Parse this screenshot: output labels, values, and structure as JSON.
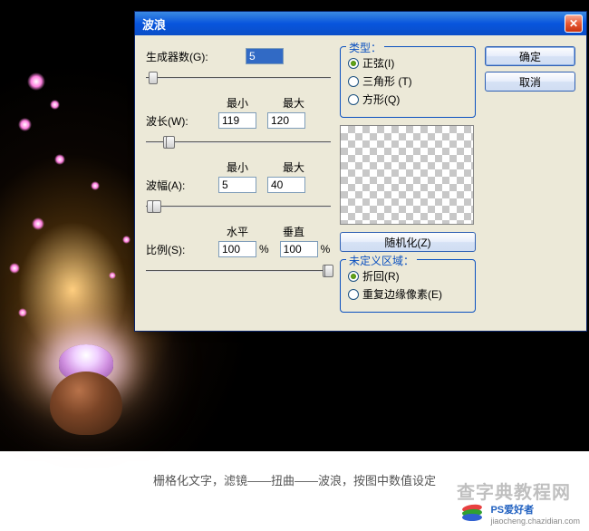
{
  "dialog": {
    "title": "波浪",
    "generators_label": "生成器数(G):",
    "generators_value": "5",
    "col_min": "最小",
    "col_max": "最大",
    "wavelength_label": "波长(W):",
    "wavelength_min": "119",
    "wavelength_max": "120",
    "amplitude_label": "波幅(A):",
    "amplitude_min": "5",
    "amplitude_max": "40",
    "col_horiz": "水平",
    "col_vert": "垂直",
    "scale_label": "比例(S):",
    "scale_h": "100",
    "scale_v": "100",
    "pct": "%",
    "type_group": "类型：",
    "type_sine": "正弦(I)",
    "type_triangle": "三角形 (T)",
    "type_square": "方形(Q)",
    "randomize": "随机化(Z)",
    "undef_group": "未定义区域：",
    "undef_wrap": "折回(R)",
    "undef_repeat": "重复边缘像素(E)",
    "ok": "确定",
    "cancel": "取消"
  },
  "caption": "栅格化文字，滤镜——扭曲——波浪，按图中数值设定",
  "logo": {
    "title": "PS爱好者",
    "sub": "jiaocheng.chazidian.com"
  },
  "watermark": "查字典教程网"
}
